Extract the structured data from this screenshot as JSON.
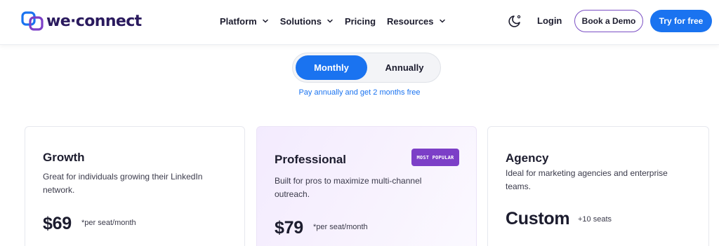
{
  "header": {
    "logo_text": "we·connect",
    "nav": [
      {
        "label": "Platform",
        "has_dropdown": true
      },
      {
        "label": "Solutions",
        "has_dropdown": true
      },
      {
        "label": "Pricing",
        "has_dropdown": false
      },
      {
        "label": "Resources",
        "has_dropdown": true
      }
    ],
    "theme_icon": "moon-icon",
    "login_label": "Login",
    "demo_label": "Book a Demo",
    "try_label": "Try for free"
  },
  "billing": {
    "monthly_label": "Monthly",
    "annually_label": "Annually",
    "selected": "Monthly",
    "promo_text": "Pay annually and get 2 months free"
  },
  "plans": [
    {
      "name": "Growth",
      "description": "Great for individuals growing their LinkedIn network.",
      "price": "$69",
      "price_note": "*per seat/month"
    },
    {
      "name": "Professional",
      "badge": "MOST POPULAR",
      "description": "Built for pros to maximize multi-channel outreach.",
      "price": "$79",
      "price_note": "*per seat/month"
    },
    {
      "name": "Agency",
      "description": "Ideal for marketing agencies and enterprise teams.",
      "price": "Custom",
      "price_note": "+10 seats"
    }
  ],
  "colors": {
    "accent_blue": "#1a73f0",
    "brand_purple": "#7c3fc7",
    "text_dark": "#1c1c2e"
  }
}
